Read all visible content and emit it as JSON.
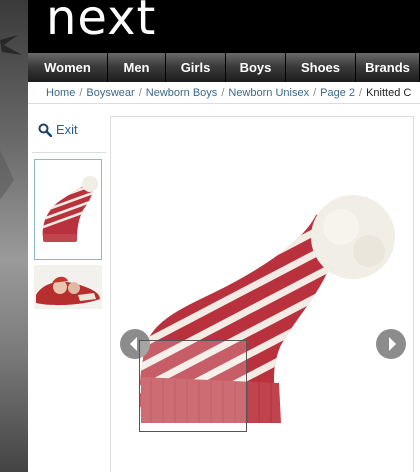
{
  "brand": {
    "logo_text": "next"
  },
  "nav": {
    "items": [
      {
        "label": "Women"
      },
      {
        "label": "Men"
      },
      {
        "label": "Girls"
      },
      {
        "label": "Boys"
      },
      {
        "label": "Shoes"
      },
      {
        "label": "Brands"
      }
    ]
  },
  "breadcrumb": {
    "items": [
      "Home",
      "Boyswear",
      "Newborn Boys",
      "Newborn Unisex",
      "Page 2"
    ],
    "separator": "/",
    "current": "Knitted C"
  },
  "sidebar": {
    "exit_label": "Exit",
    "thumbnails": [
      {
        "name": "hat-thumbnail",
        "selected": true
      },
      {
        "name": "baby-photo-thumbnail",
        "selected": false
      }
    ]
  },
  "viewer": {
    "icon_prev": "chevron-left-icon",
    "icon_next": "chevron-right-icon",
    "zoom_lens": true
  },
  "colors": {
    "header_bg": "#000000",
    "hat_red": "#b8313d",
    "hat_stripe": "#f4ece4",
    "link": "#3b6a8a"
  }
}
